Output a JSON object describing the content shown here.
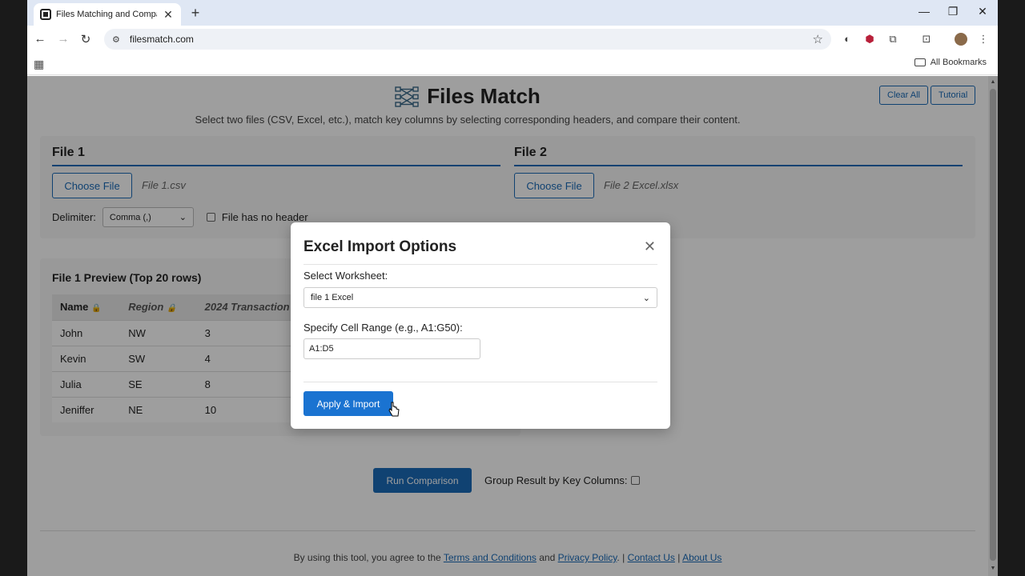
{
  "browser": {
    "tab_title": "Files Matching and Comparison",
    "url": "filesmatch.com",
    "bookmarks_label": "All Bookmarks"
  },
  "header": {
    "title": "Files Match",
    "subtitle": "Select two files (CSV, Excel, etc.), match key columns by selecting corresponding headers, and compare their content.",
    "clear_all": "Clear All",
    "tutorial": "Tutorial"
  },
  "file1": {
    "title": "File 1",
    "choose_label": "Choose File",
    "file_name": "File 1.csv",
    "delimiter_label": "Delimiter:",
    "delimiter_value": "Comma (,)",
    "no_header_label": "File has no header"
  },
  "file2": {
    "title": "File 2",
    "choose_label": "Choose File",
    "file_name": "File 2 Excel.xlsx"
  },
  "preview": {
    "title": "File 1 Preview (Top 20 rows)",
    "columns": [
      "Name",
      "Region",
      "2024 Transaction"
    ],
    "rows": [
      [
        "John",
        "NW",
        "3"
      ],
      [
        "Kevin",
        "SW",
        "4"
      ],
      [
        "Julia",
        "SE",
        "8"
      ],
      [
        "Jeniffer",
        "NE",
        "10"
      ]
    ]
  },
  "actions": {
    "run_comparison": "Run Comparison",
    "group_label": "Group Result by Key Columns:"
  },
  "footer": {
    "prefix": "By using this tool, you agree to the",
    "terms": "Terms and Conditions",
    "and": "and",
    "privacy": "Privacy Policy",
    "sep1": ".",
    "contact": "Contact Us",
    "about": "About Us"
  },
  "modal": {
    "title": "Excel Import Options",
    "worksheet_label": "Select Worksheet:",
    "worksheet_value": "file 1 Excel",
    "range_label": "Specify Cell Range (e.g., A1:G50):",
    "range_value": "A1:D5",
    "apply_label": "Apply & Import"
  },
  "colors": {
    "accent": "#1a6bb8",
    "apply": "#1a73d1"
  }
}
